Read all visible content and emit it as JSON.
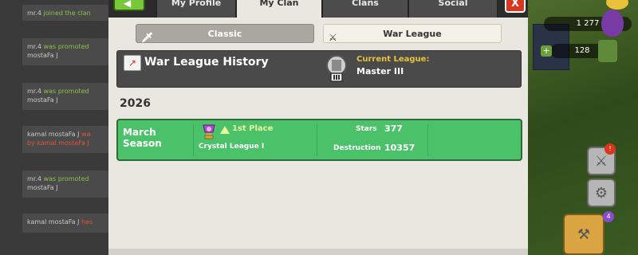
{
  "chat": {
    "messages": [
      {
        "actor": "mr.4",
        "action": "joined the clan",
        "rest": ""
      },
      {
        "actor": "mr.4",
        "action": "was promoted",
        "rest": "mostaFa J"
      },
      {
        "actor": "mr.4",
        "action": "was promoted",
        "rest": "mostaFa J"
      },
      {
        "actor": "kamal mostaFa J",
        "action": "wa",
        "rest": "by kamal mostaFa J"
      },
      {
        "actor": "mr.4",
        "action": "was promoted",
        "rest": "mostaFa J"
      },
      {
        "actor": "kamal mostaFa J",
        "action": "has",
        "rest": ""
      }
    ]
  },
  "tabs": {
    "back_label": "◀",
    "my_profile": "My Profile",
    "my_clan": "My Clan",
    "clans": "Clans",
    "social": "Social",
    "close_label": "X"
  },
  "subtabs": {
    "classic": "Classic",
    "war_league": "War League"
  },
  "history": {
    "title": "War League History",
    "current_league_label": "Current League:",
    "current_league_value": "Master III"
  },
  "year": "2026",
  "season": {
    "name_line1": "March",
    "name_line2": "Season",
    "place": "1st Place",
    "league": "Crystal League I",
    "stars_label": "Stars",
    "stars_value": "377",
    "destruction_label": "Destruction",
    "destruction_value": "10357"
  },
  "hud": {
    "gems": "1 277",
    "elixir": "128",
    "notif_alert": "!",
    "notif_count": "4"
  },
  "colors": {
    "accent_green": "#4bc26a",
    "league_label": "#e8c23a",
    "place_text": "#e8f59a",
    "close_red": "#d9361f"
  }
}
